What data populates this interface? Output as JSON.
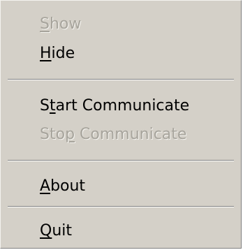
{
  "menu": {
    "items": [
      {
        "pre": "",
        "mnemonic": "S",
        "post": "how",
        "enabled": false
      },
      {
        "pre": "",
        "mnemonic": "H",
        "post": "ide",
        "enabled": true
      },
      {
        "pre": "S",
        "mnemonic": "t",
        "post": "art Communicate",
        "enabled": true
      },
      {
        "pre": "Sto",
        "mnemonic": "p",
        "post": " Communicate",
        "enabled": false
      },
      {
        "pre": "",
        "mnemonic": "A",
        "post": "bout",
        "enabled": true
      },
      {
        "pre": "",
        "mnemonic": "Q",
        "post": "uit",
        "enabled": true
      }
    ]
  }
}
